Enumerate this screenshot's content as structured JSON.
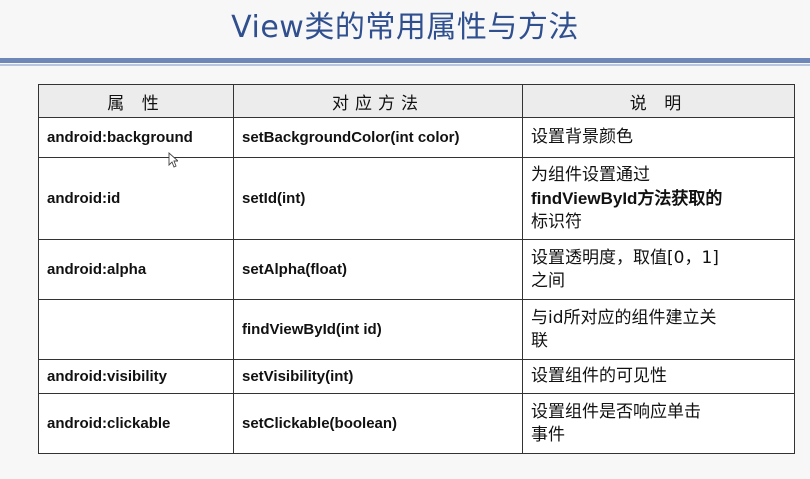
{
  "title": "View类的常用属性与方法",
  "table": {
    "headers": [
      "属 性",
      "对应方法",
      "说 明"
    ],
    "rows": [
      {
        "attr": "android:background",
        "method": "setBackgroundColor(int color)",
        "desc": [
          "设置背景颜色"
        ]
      },
      {
        "attr": "android:id",
        "method": "setId(int)",
        "desc": [
          "为组件设置通过",
          "findViewById方法获取的",
          "标识符"
        ]
      },
      {
        "attr": "android:alpha",
        "method": "setAlpha(float)",
        "desc": [
          "设置透明度，取值[0，1]",
          "之间"
        ]
      },
      {
        "attr": "",
        "method": "findViewById(int id)",
        "desc": [
          "与id所对应的组件建立关",
          "联"
        ]
      },
      {
        "attr": "android:visibility",
        "method": "setVisibility(int)",
        "desc": [
          "设置组件的可见性"
        ]
      },
      {
        "attr": "android:clickable",
        "method": "setClickable(boolean)",
        "desc": [
          "设置组件是否响应单击",
          "事件"
        ]
      }
    ]
  }
}
